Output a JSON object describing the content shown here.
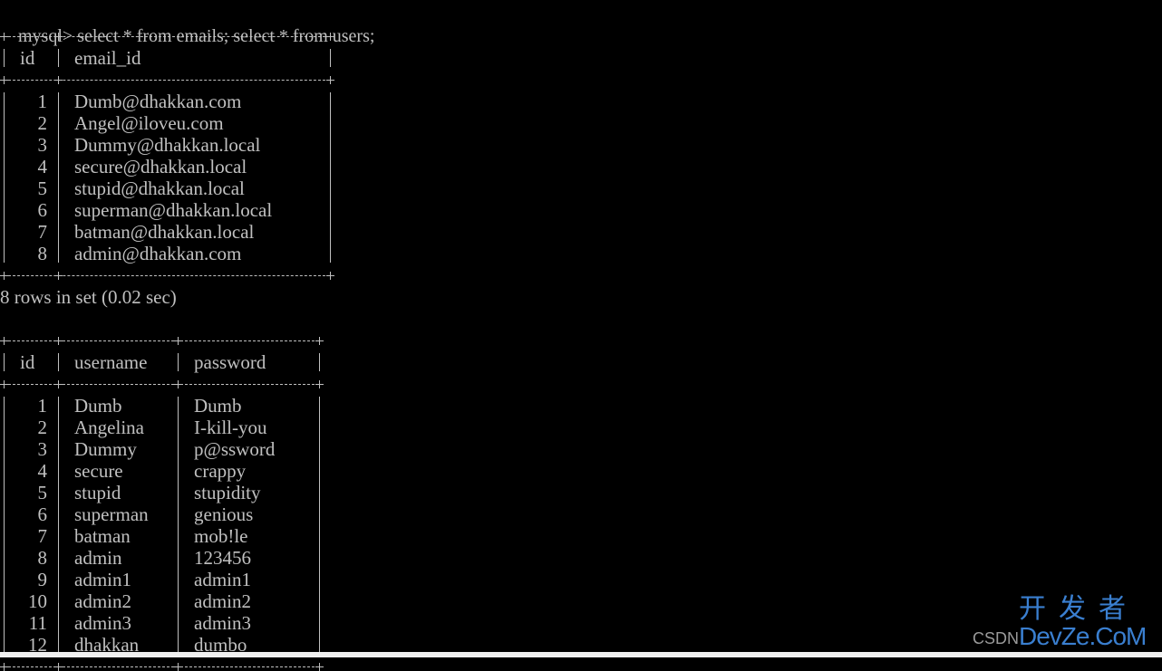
{
  "terminal": {
    "prompt": "mysql>",
    "command": "select * from emails; select * from users;",
    "background_color": "#000000",
    "text_color": "#c0c0c0"
  },
  "emails_table": {
    "columns": [
      "id",
      "email_id"
    ],
    "rows": [
      [
        "1",
        "Dumb@dhakkan.com"
      ],
      [
        "2",
        "Angel@iloveu.com"
      ],
      [
        "3",
        "Dummy@dhakkan.local"
      ],
      [
        "4",
        "secure@dhakkan.local"
      ],
      [
        "5",
        "stupid@dhakkan.local"
      ],
      [
        "6",
        "superman@dhakkan.local"
      ],
      [
        "7",
        "batman@dhakkan.local"
      ],
      [
        "8",
        "admin@dhakkan.com"
      ]
    ],
    "summary": "8 rows in set (0.02 sec)"
  },
  "users_table": {
    "columns": [
      "id",
      "username",
      "password"
    ],
    "rows": [
      [
        "1",
        "Dumb",
        "Dumb"
      ],
      [
        "2",
        "Angelina",
        "I-kill-you"
      ],
      [
        "3",
        "Dummy",
        "p@ssword"
      ],
      [
        "4",
        "secure",
        "crappy"
      ],
      [
        "5",
        "stupid",
        "stupidity"
      ],
      [
        "6",
        "superman",
        "genious"
      ],
      [
        "7",
        "batman",
        "mob!le"
      ],
      [
        "8",
        "admin",
        "123456"
      ],
      [
        "9",
        "admin1",
        "admin1"
      ],
      [
        "10",
        "admin2",
        "admin2"
      ],
      [
        "11",
        "admin3",
        "admin3"
      ],
      [
        "12",
        "dhakkan",
        "dumbo"
      ]
    ]
  },
  "watermark": {
    "cn_text": "开发者",
    "csdn_text": "CSDN",
    "site_text": "DevZe.CoM",
    "color": "#3a7fd0"
  }
}
